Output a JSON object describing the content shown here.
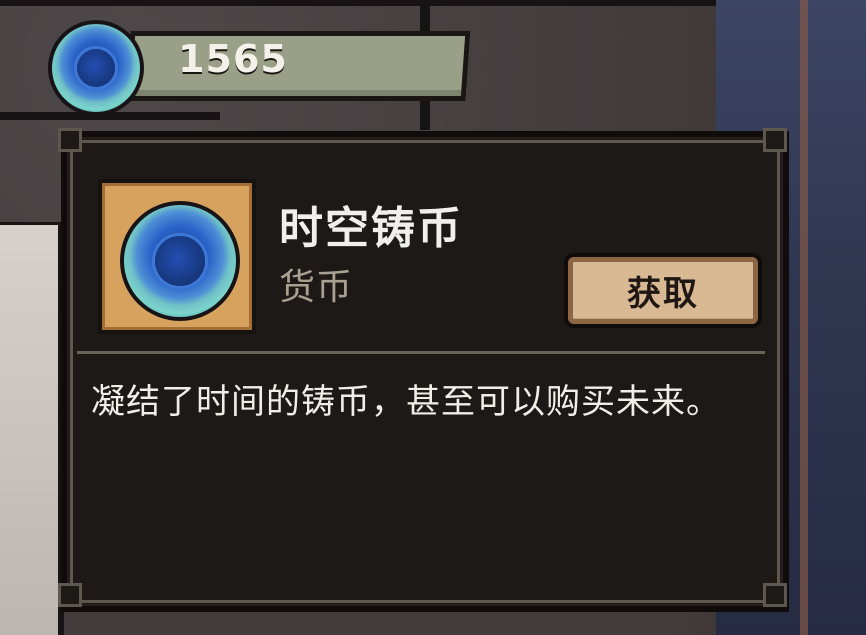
{
  "currency": {
    "amount": "1565",
    "icon": "time-space-coin-icon"
  },
  "item": {
    "name": "时空铸币",
    "type": "货币",
    "icon": "time-space-coin-icon",
    "get_button_label": "获取",
    "description": "凝结了时间的铸币，甚至可以购买未来。"
  },
  "colors": {
    "panel_bg": "#1c1917",
    "tile_bg": "#d7a25d",
    "button_bg": "#d9b994",
    "currency_plate": "#9aa088",
    "text_primary": "#f0efea",
    "text_secondary": "#a9a092"
  }
}
